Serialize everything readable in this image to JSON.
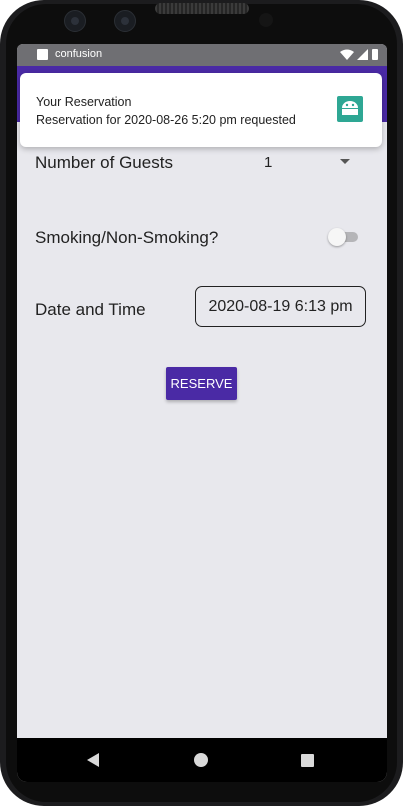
{
  "status_bar": {
    "app_name": "confusion",
    "icons": [
      "wifi-icon",
      "cellular-signal-icon",
      "battery-icon"
    ]
  },
  "notification": {
    "title": "Your Reservation",
    "text": "Reservation for 2020-08-26 5:20 pm requested",
    "icon": "android-app-icon"
  },
  "form": {
    "guests_label": "Number of Guests",
    "guests_value": "1",
    "smoking_label": "Smoking/Non-Smoking?",
    "smoking_enabled": false,
    "date_label": "Date and Time",
    "date_value": "2020-08-19 6:13 pm",
    "reserve_label": "RESERVE"
  },
  "nav_bar": {
    "buttons": [
      "back-icon",
      "home-icon",
      "recents-icon"
    ]
  },
  "colors": {
    "primary": "#4a2aa5",
    "screen_background": "#e8e8ed",
    "status_bar": "#6f6f73",
    "notification_icon": "#2ea794"
  }
}
